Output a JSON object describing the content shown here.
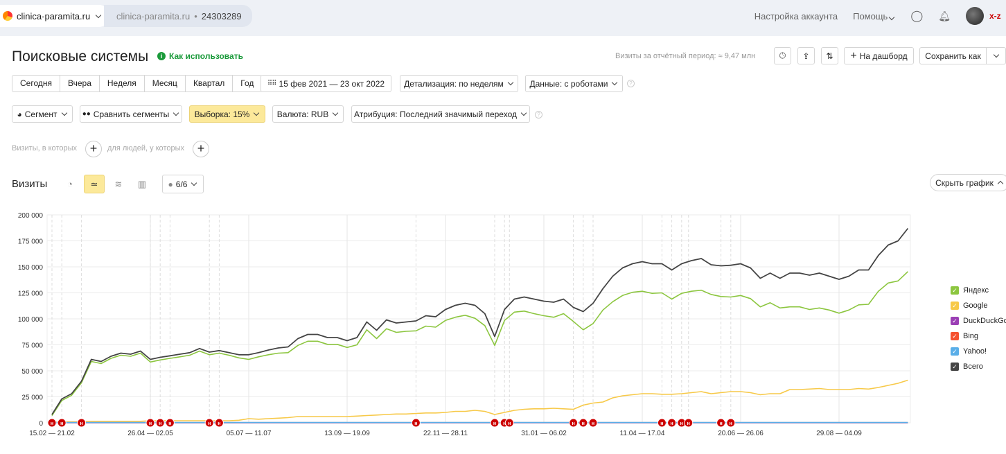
{
  "topbar": {
    "site": "clinica-paramita.ru",
    "counter_site": "clinica-paramita.ru",
    "counter_sep": "•",
    "counter_id": "24303289",
    "account_settings": "Настройка аккаунта",
    "help": "Помощь",
    "user": "x-z"
  },
  "header": {
    "title": "Поисковые системы",
    "how_to": "Как использовать",
    "visits_total": "Визиты за отчётный период: ≈ 9,47 млн",
    "to_dashboard": "На дашборд",
    "save_as": "Сохранить как"
  },
  "periods": [
    "Сегодня",
    "Вчера",
    "Неделя",
    "Месяц",
    "Квартал",
    "Год"
  ],
  "date_range": "15 фев 2021 — 23 окт 2022",
  "detail": "Детализация: по неделям",
  "data_mode": "Данные: с роботами",
  "segment": "Сегмент",
  "compare": "Сравнить сегменты",
  "sample": "Выборка: 15%",
  "currency": "Валюта: RUB",
  "attribution": "Атрибуция: Последний значимый переход",
  "filters": {
    "visits_where": "Визиты, в которых",
    "people_where": "для людей, у которых"
  },
  "chart_header": {
    "title": "Визиты",
    "notes_count": "6/6",
    "hide_chart": "Скрыть график"
  },
  "colors": {
    "yandex": "#8cc63f",
    "google": "#f7c948",
    "duckduckgo": "#9b3fb5",
    "bing": "#f5512f",
    "yahoo": "#5aaee8",
    "total": "#444444",
    "accent": "#fce99a",
    "note": "#cc0000"
  },
  "chart_data": {
    "type": "line",
    "title": "Визиты",
    "xlabel": "",
    "ylabel": "",
    "ylim": [
      0,
      200000
    ],
    "yticks": [
      "0",
      "25 000",
      "50 000",
      "75 000",
      "100 000",
      "125 000",
      "150 000",
      "175 000",
      "200 000"
    ],
    "xtick_labels": [
      {
        "week_index": 0,
        "label": "15.02 — 21.02"
      },
      {
        "week_index": 10,
        "label": "26.04 — 02.05"
      },
      {
        "week_index": 20,
        "label": "05.07 — 11.07"
      },
      {
        "week_index": 30,
        "label": "13.09 — 19.09"
      },
      {
        "week_index": 40,
        "label": "22.11 — 28.11"
      },
      {
        "week_index": 50,
        "label": "31.01 — 06.02"
      },
      {
        "week_index": 60,
        "label": "11.04 — 17.04"
      },
      {
        "week_index": 70,
        "label": "20.06 — 26.06"
      },
      {
        "week_index": 80,
        "label": "29.08 — 04.09"
      }
    ],
    "grid": true,
    "legend_position": "right",
    "note_week_indices": [
      0,
      1,
      3,
      10,
      11,
      12,
      16,
      17,
      37,
      45,
      46,
      46.5,
      53,
      54,
      55,
      62,
      63,
      64,
      64.7,
      68,
      69
    ],
    "series": [
      {
        "name": "Яндекс",
        "key": "yandex",
        "values": [
          7,
          21.5,
          26.5,
          38.5,
          59,
          57,
          62,
          65,
          64,
          67,
          58.5,
          60.5,
          62,
          63.5,
          65,
          69,
          65.5,
          67,
          65,
          62.5,
          61,
          63.5,
          65.5,
          67,
          67.5,
          74.5,
          78.5,
          78.5,
          75.5,
          75.5,
          72.5,
          75,
          89.5,
          81,
          90.5,
          87,
          88,
          88.5,
          93,
          92,
          98.5,
          101.5,
          103.5,
          100.5,
          93.5,
          74.5,
          98.5,
          106.5,
          107.5,
          105,
          103,
          101.5,
          105,
          97.5,
          89.5,
          95.5,
          108.5,
          116.5,
          122.5,
          125.5,
          126.5,
          124.5,
          125,
          119,
          124.5,
          126.5,
          127.5,
          123.5,
          121.5,
          121,
          122.5,
          119.5,
          111.5,
          115.5,
          110.5,
          111.5,
          111.5,
          109,
          110.5,
          108.5,
          105.5,
          108.5,
          113.5,
          114,
          126.5,
          134.5,
          136.5,
          145.5
        ]
      },
      {
        "name": "Google",
        "key": "google",
        "values": [
          0.5,
          1,
          1,
          1,
          1.5,
          1.5,
          1.5,
          1.5,
          1.5,
          1.5,
          2,
          2,
          2,
          2,
          2,
          2,
          2,
          2,
          2,
          2.5,
          4,
          3.5,
          4,
          4.5,
          5,
          6,
          6,
          6,
          6,
          6,
          6,
          6.5,
          7,
          7.5,
          8,
          8.5,
          8.5,
          9,
          9.5,
          9.5,
          10,
          11,
          11,
          12,
          11,
          8,
          10,
          12,
          13,
          13.5,
          13.5,
          14,
          13.5,
          13,
          17,
          19,
          20,
          24,
          26,
          27,
          28,
          28,
          27.5,
          27.5,
          28,
          29,
          30,
          28,
          29,
          30,
          30,
          29,
          27,
          28,
          28,
          32,
          32,
          32.5,
          33,
          32,
          32,
          32,
          33,
          32.5,
          34,
          36,
          38,
          41
        ]
      },
      {
        "name": "DuckDuckGo",
        "key": "duckduckgo",
        "values": "near-zero",
        "const": 0.1
      },
      {
        "name": "Bing",
        "key": "bing",
        "values": "near-zero",
        "const": 0.2
      },
      {
        "name": "Yahoo!",
        "key": "yahoo",
        "values": "near-zero",
        "const": 0.3
      },
      {
        "name": "Всего",
        "key": "total",
        "values": [
          8,
          23,
          28,
          40,
          61,
          59,
          64,
          67,
          66,
          69,
          61,
          63,
          64.5,
          66,
          67.5,
          71.5,
          68,
          69.5,
          67.5,
          65.5,
          65.5,
          67.5,
          70,
          72,
          73,
          81,
          85,
          85,
          82,
          82,
          79,
          82,
          97,
          89,
          99,
          96,
          97,
          98,
          103,
          102,
          109,
          113,
          115,
          113,
          105,
          83,
          109,
          119,
          121,
          119,
          117,
          116,
          119,
          111,
          107,
          115,
          129,
          141,
          149,
          153,
          155,
          153,
          153,
          147,
          153,
          156,
          158,
          152,
          151,
          151.5,
          153,
          149,
          139,
          144,
          139,
          144,
          144,
          142,
          144,
          141,
          138,
          141,
          147,
          147,
          161,
          171,
          175,
          187
        ]
      }
    ],
    "value_unit": "thousand visits"
  }
}
